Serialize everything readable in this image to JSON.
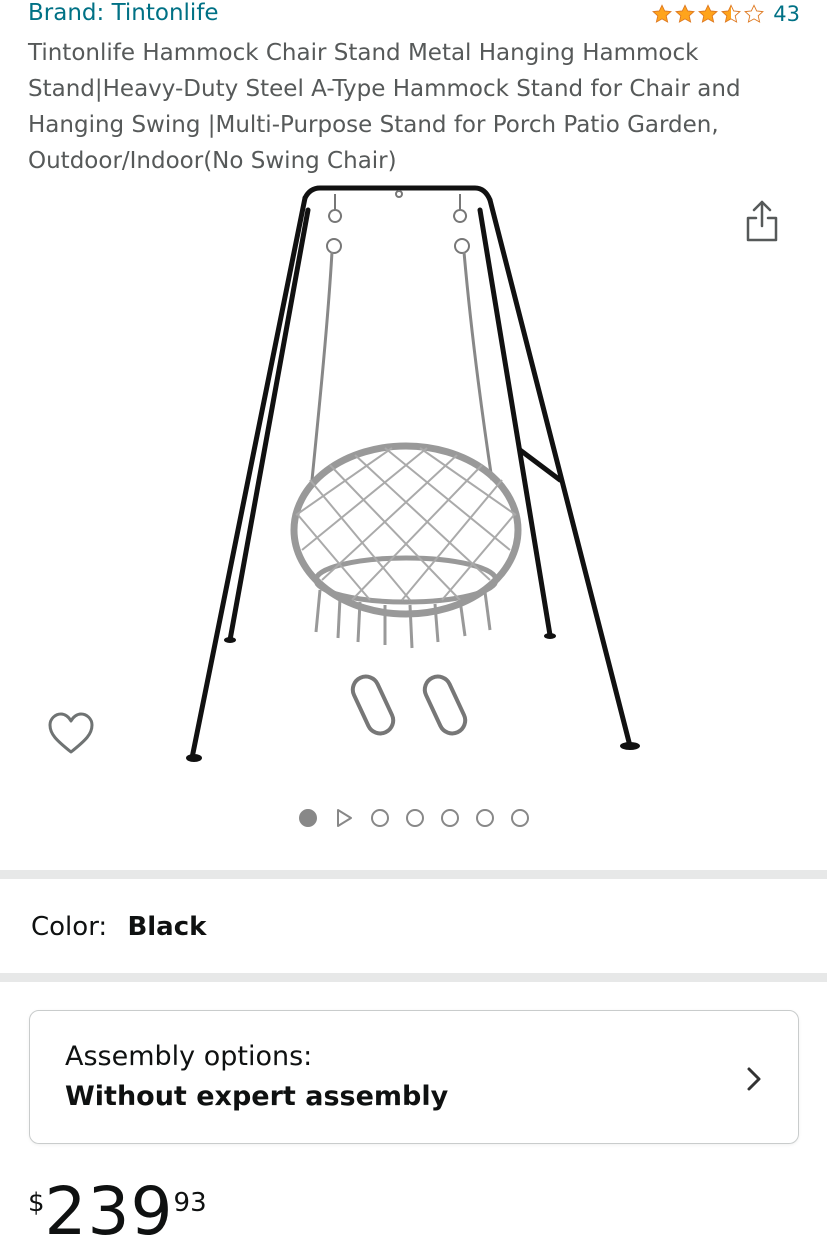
{
  "brand": {
    "label": "Brand: Tintonlife"
  },
  "rating": {
    "stars": 3.5,
    "max_stars": 5,
    "count": "43",
    "star_color": "#ffa41c"
  },
  "title": "Tintonlife Hammock Chair Stand Metal Hanging Hammock Stand|Heavy-Duty Steel A-Type Hammock Stand for Chair and Hanging Swing |Multi-Purpose Stand for Porch Patio Garden, Outdoor/Indoor(No Swing Chair)",
  "gallery": {
    "total_items": 7,
    "active_index": 0,
    "video_index": 1
  },
  "color": {
    "label": "Color:",
    "value": "Black"
  },
  "assembly": {
    "label": "Assembly options:",
    "value": "Without expert assembly"
  },
  "price": {
    "symbol": "$",
    "whole": "239",
    "fraction": "93"
  },
  "icons": {
    "share": "share-icon",
    "wishlist": "heart-icon",
    "chevron": "chevron-right-icon",
    "play": "play-icon"
  }
}
